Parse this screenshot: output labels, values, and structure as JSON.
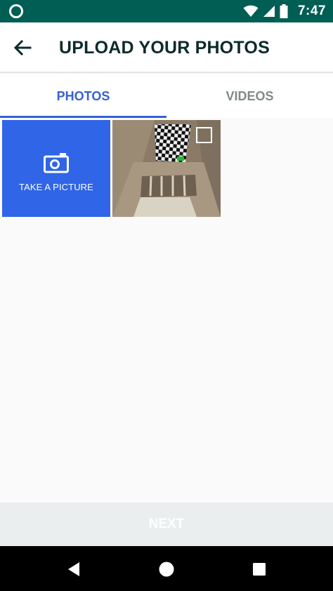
{
  "status_bar": {
    "time": "7:47",
    "icons": [
      "notification-ring-icon",
      "wifi-icon",
      "cell-signal-icon",
      "battery-icon"
    ]
  },
  "app_bar": {
    "title": "UPLOAD YOUR PHOTOS",
    "back_icon": "back-arrow-icon"
  },
  "tabs": [
    {
      "label": "PHOTOS",
      "active": true
    },
    {
      "label": "VIDEOS",
      "active": false
    }
  ],
  "grid": {
    "take_picture_label": "TAKE A PICTURE",
    "take_picture_icon": "camera-icon",
    "photos": [
      {
        "selected": false
      }
    ]
  },
  "next_button": {
    "label": "NEXT",
    "enabled": false
  },
  "nav_bar": {
    "icons": [
      "back-triangle-icon",
      "home-circle-icon",
      "recents-square-icon"
    ]
  },
  "colors": {
    "status_bar": "#005e54",
    "accent": "#3461d6",
    "take_picture_tile": "#2f65e6",
    "next_bar": "#eaeeee"
  }
}
